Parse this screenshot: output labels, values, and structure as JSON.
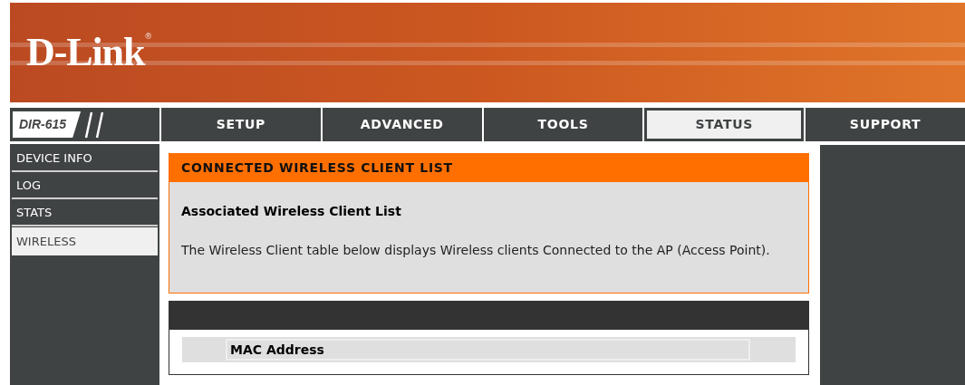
{
  "brand": {
    "logo": "D-Link",
    "mark": "®"
  },
  "model": "DIR-615",
  "tabs": [
    {
      "label": "SETUP",
      "selected": false
    },
    {
      "label": "ADVANCED",
      "selected": false
    },
    {
      "label": "TOOLS",
      "selected": false
    },
    {
      "label": "STATUS",
      "selected": true
    },
    {
      "label": "SUPPORT",
      "selected": false
    }
  ],
  "sidebar": {
    "items": [
      {
        "label": "DEVICE INFO",
        "selected": false
      },
      {
        "label": "LOG",
        "selected": false
      },
      {
        "label": "STATS",
        "selected": false
      },
      {
        "label": "WIRELESS",
        "selected": true
      }
    ]
  },
  "section": {
    "title": "CONNECTED WIRELESS CLIENT LIST",
    "heading": "Associated Wireless Client List",
    "text": "The Wireless Client table below displays Wireless clients Connected to the AP (Access Point)."
  },
  "table": {
    "columns": [
      "MAC Address"
    ]
  }
}
